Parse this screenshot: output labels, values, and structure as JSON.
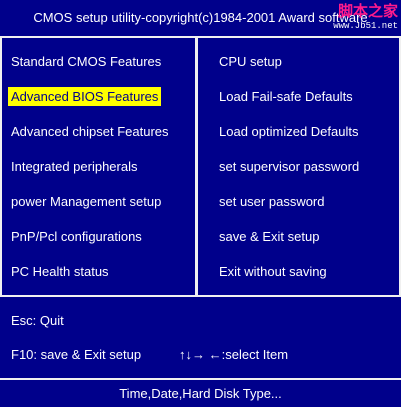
{
  "header": {
    "title": "CMOS setup utility-copyright(c)1984-2001 Award software",
    "watermark_top": "脚本之家",
    "watermark_bottom": "www.Jb51.net"
  },
  "menu_left": [
    {
      "label": "Standard CMOS Features"
    },
    {
      "label": "Advanced BIOS Features",
      "selected": true
    },
    {
      "label": "Advanced chipset Features"
    },
    {
      "label": "Integrated peripherals"
    },
    {
      "label": "power Management setup"
    },
    {
      "label": "PnP/Pcl configurations"
    },
    {
      "label": "PC Health status"
    }
  ],
  "menu_right": [
    {
      "label": "CPU setup"
    },
    {
      "label": "Load Fail-safe Defaults"
    },
    {
      "label": "Load optimized Defaults"
    },
    {
      "label": "set supervisor password"
    },
    {
      "label": "set user password"
    },
    {
      "label": "save & Exit setup"
    },
    {
      "label": "Exit without saving"
    }
  ],
  "help": {
    "esc": "Esc: Quit",
    "f10": "F10: save & Exit setup",
    "nav": "↑↓→ ←:select Item"
  },
  "status": "Time,Date,Hard Disk Type...",
  "colors": {
    "background": "#00008B",
    "text": "#FFFFFF",
    "highlight": "#FFFF00",
    "border": "#F0F0F0",
    "watermark": "#FF1A8C"
  }
}
